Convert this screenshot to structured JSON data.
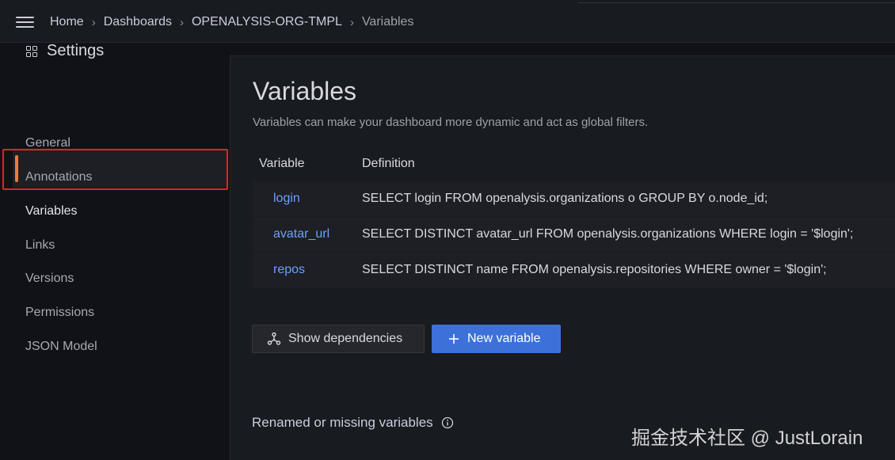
{
  "header": {
    "breadcrumbs": [
      "Home",
      "Dashboards",
      "OPENALYSIS-ORG-TMPL",
      "Variables"
    ],
    "separator": "›"
  },
  "sidebar": {
    "title": "Settings",
    "items": [
      {
        "label": "General",
        "active": false
      },
      {
        "label": "Annotations",
        "active": false
      },
      {
        "label": "Variables",
        "active": true
      },
      {
        "label": "Links",
        "active": false
      },
      {
        "label": "Versions",
        "active": false
      },
      {
        "label": "Permissions",
        "active": false
      },
      {
        "label": "JSON Model",
        "active": false
      }
    ]
  },
  "main": {
    "title": "Variables",
    "description": "Variables can make your dashboard more dynamic and act as global filters.",
    "table": {
      "headers": [
        "Variable",
        "Definition"
      ],
      "rows": [
        {
          "name": "login",
          "definition": "SELECT login FROM openalysis.organizations o GROUP BY o.node_id;"
        },
        {
          "name": "avatar_url",
          "definition": "SELECT DISTINCT avatar_url FROM openalysis.organizations WHERE login = '$login';"
        },
        {
          "name": "repos",
          "definition": "SELECT DISTINCT name FROM openalysis.repositories WHERE owner = '$login';"
        }
      ]
    },
    "buttons": {
      "show_dependencies": "Show dependencies",
      "new_variable": "New variable"
    },
    "renamed_section": "Renamed or missing variables"
  },
  "watermark": "掘金技术社区 @ JustLorain",
  "colors": {
    "accent": "#3d71d9",
    "link": "#6e9fff",
    "active_indicator": "#f07a3b",
    "highlight_box": "#e0232d"
  }
}
